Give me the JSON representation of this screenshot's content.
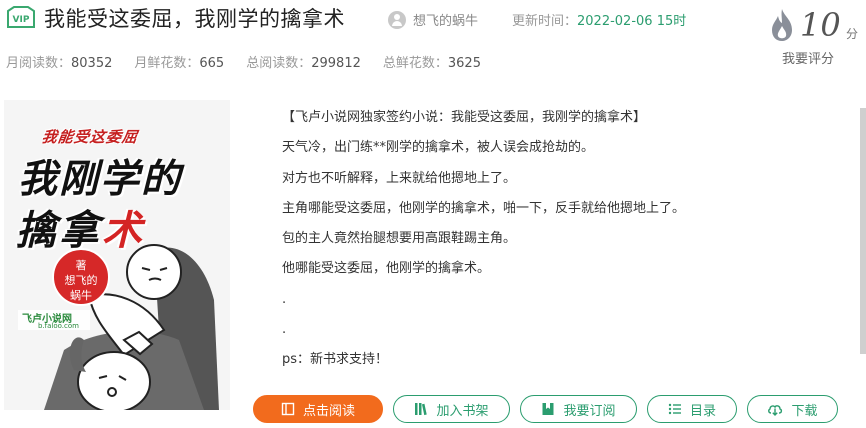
{
  "header": {
    "vip_badge": "VIP",
    "title": "我能受这委屈，我刚学的擒拿术",
    "author": "想飞的蜗牛",
    "updated_label": "更新时间：",
    "updated_value": "2022-02-06 15时"
  },
  "score": {
    "value": "10",
    "unit": "分",
    "rate_label": "我要评分",
    "icon": "flame-icon"
  },
  "stats": [
    {
      "label": "月阅读数：",
      "value": "80352"
    },
    {
      "label": "月鲜花数：",
      "value": "665"
    },
    {
      "label": "总阅读数：",
      "value": "299812"
    },
    {
      "label": "总鲜花数：",
      "value": "3625"
    }
  ],
  "cover": {
    "top_text": "我能受这委屈",
    "mid_text": "我刚学的",
    "low_text_a": "擒拿",
    "low_text_b": "术",
    "badge_line1": "著",
    "badge_line2": "想飞的",
    "badge_line3": "蜗牛",
    "logo": "飞卢小说网",
    "logo_sub": "b.faloo.com"
  },
  "synopsis": [
    "【飞卢小说网独家签约小说：我能受这委屈，我刚学的擒拿术】",
    "天气冷，出门练**刚学的擒拿术，被人误会成抢劫的。",
    "对方也不听解释，上来就给他摁地上了。",
    "主角哪能受这委屈，他刚学的擒拿术，啪一下，反手就给他摁地上了。",
    "包的主人竟然抬腿想要用高跟鞋踢主角。",
    "他哪能受这委屈，他刚学的擒拿术。",
    ".",
    ".",
    "ps：新书求支持！"
  ],
  "buttons": {
    "read": "点击阅读",
    "shelf": "加入书架",
    "subscribe": "我要订阅",
    "catalog": "目录",
    "download": "下载"
  },
  "colors": {
    "accent_green": "#2b9d6f",
    "primary_orange": "#f26b1d"
  }
}
